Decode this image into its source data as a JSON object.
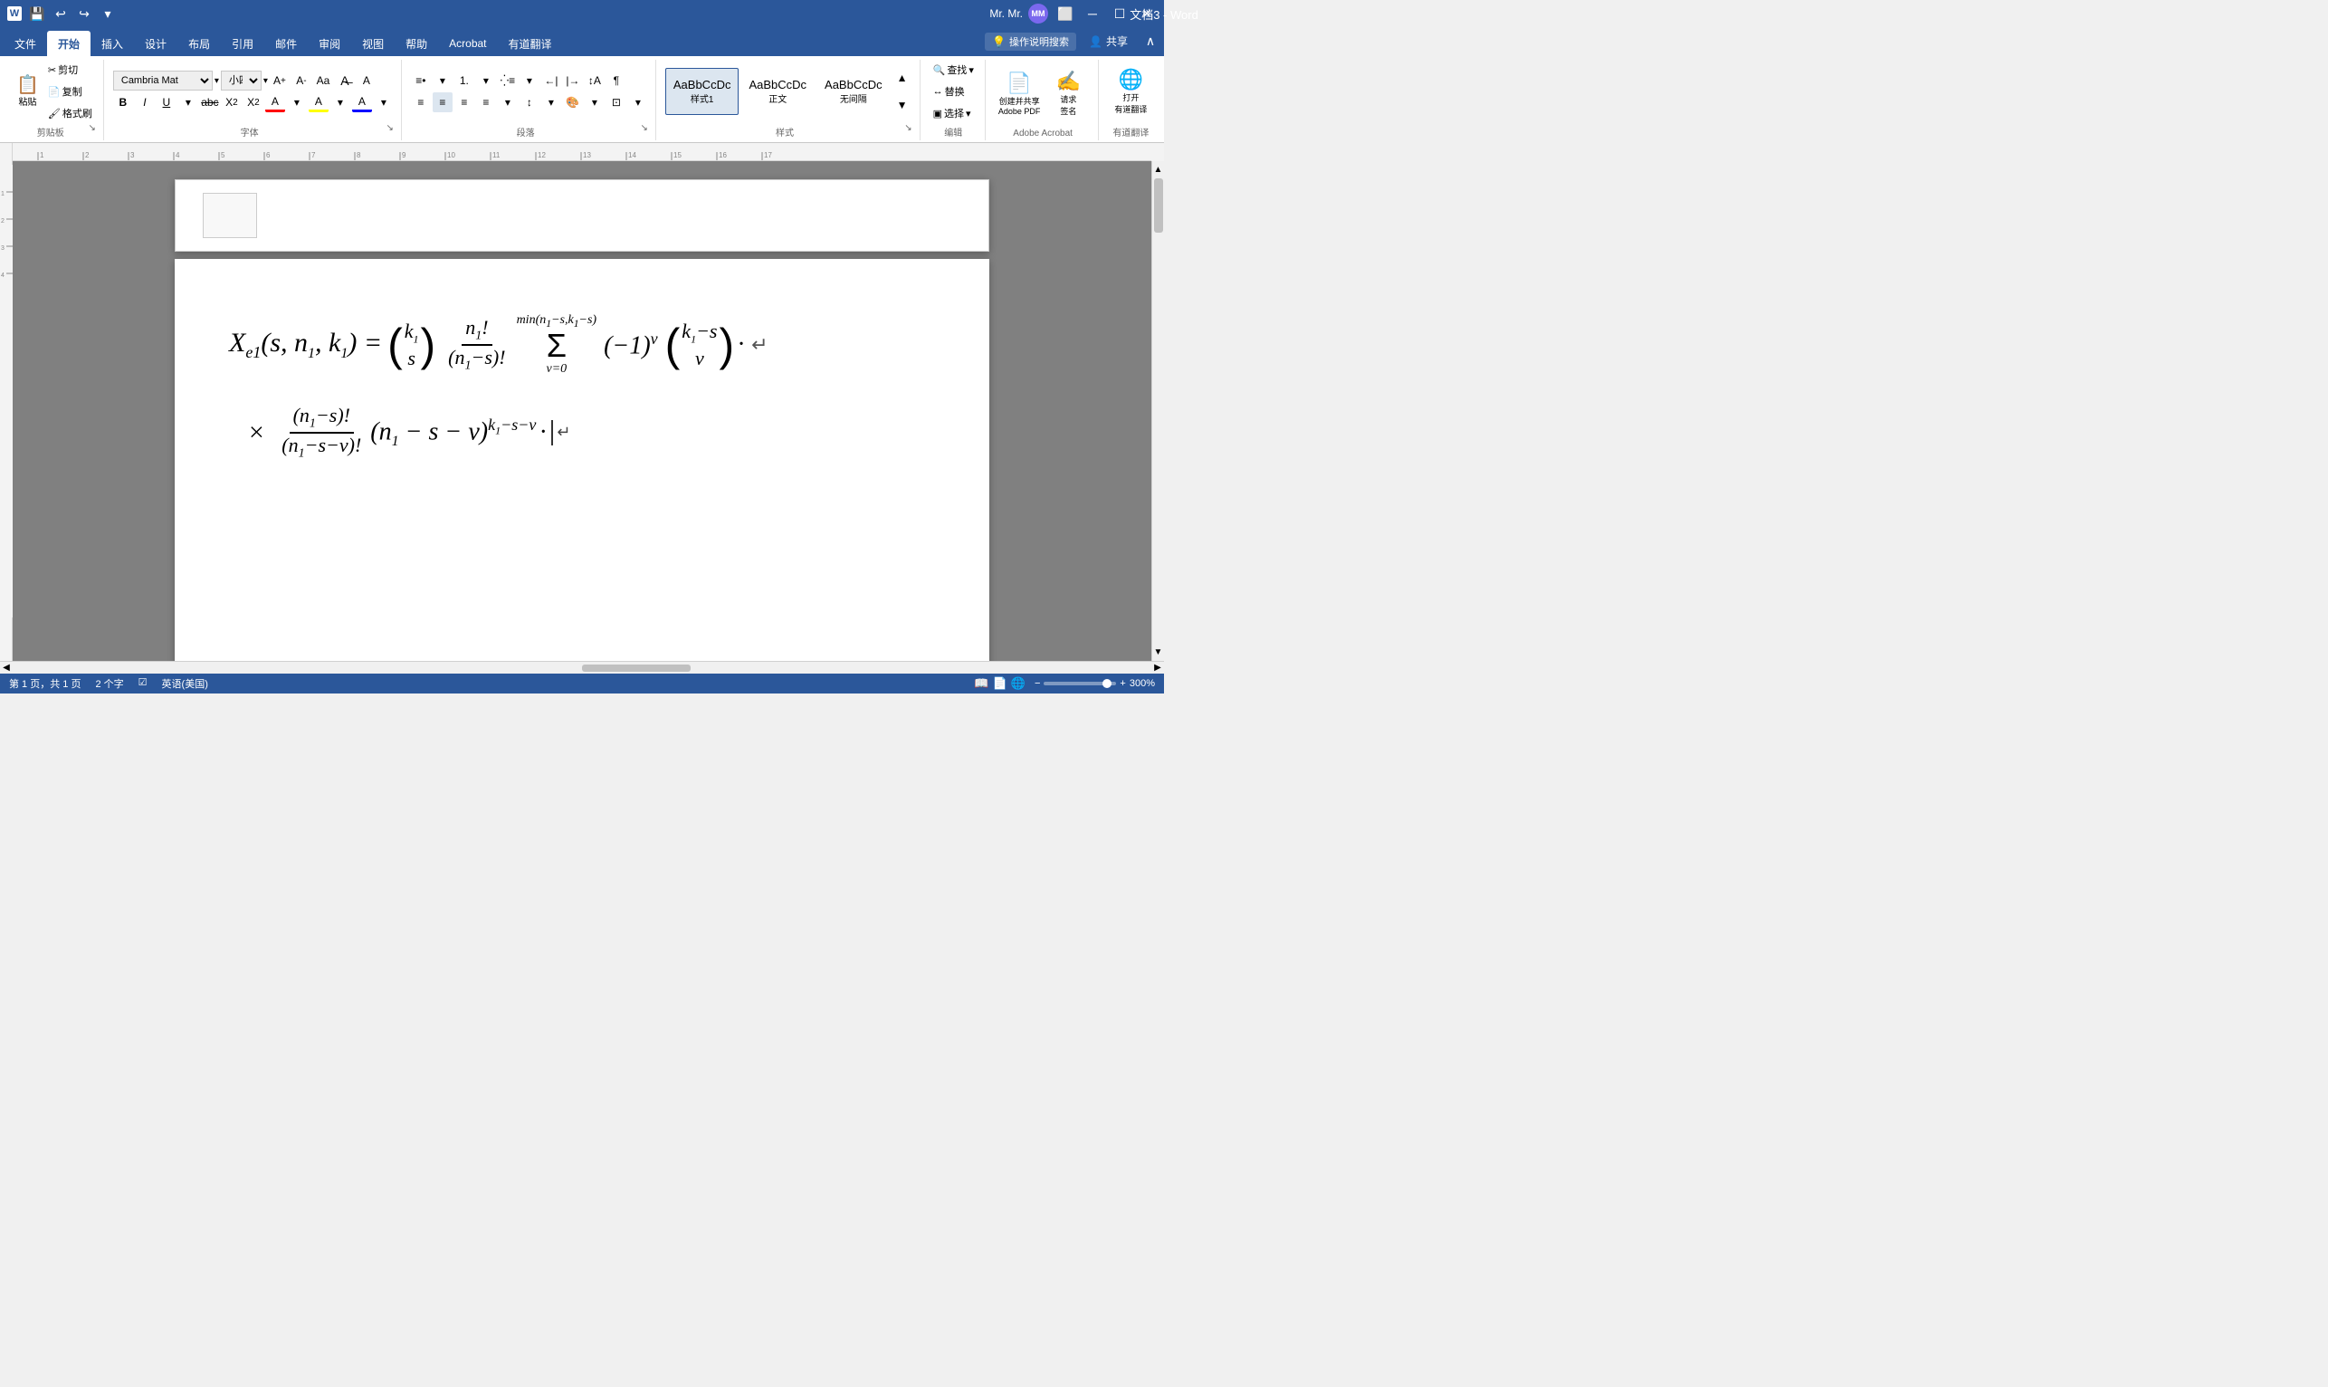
{
  "titlebar": {
    "title": "文档3 - Word",
    "app": "Word",
    "user": "Mr. Mr.",
    "user_initials": "MM",
    "quicktools": [
      "save",
      "undo",
      "redo",
      "dropdown"
    ]
  },
  "ribbontabs": {
    "tabs": [
      "文件",
      "开始",
      "插入",
      "设计",
      "布局",
      "引用",
      "邮件",
      "审阅",
      "视图",
      "帮助",
      "Acrobat",
      "有道翻译"
    ],
    "active": "开始"
  },
  "ribbon": {
    "clipboard": {
      "label": "剪贴板",
      "paste_label": "粘贴",
      "expand": "↘"
    },
    "font": {
      "label": "字体",
      "font_name": "Cambria Mat",
      "font_size": "小四",
      "bold": "B",
      "italic": "I",
      "underline": "U",
      "strikethrough": "abc",
      "subscript": "X₂",
      "superscript": "X²",
      "font_color": "A",
      "highlight": "A",
      "clear": "A",
      "expand": "↘"
    },
    "paragraph": {
      "label": "段落",
      "expand": "↘"
    },
    "styles": {
      "label": "样式",
      "items": [
        {
          "name": "样式1",
          "preview": "AaBbCcDc",
          "active": true
        },
        {
          "name": "正文",
          "preview": "AaBbCcDc"
        },
        {
          "name": "无间隔",
          "preview": "AaBbCcDc"
        }
      ],
      "expand": "↘"
    },
    "editing": {
      "label": "编辑",
      "find": "查找",
      "replace": "替换",
      "select": "选择"
    },
    "acrobat": {
      "label": "Adobe Acrobat",
      "create_share": "创建并共享\nAdobe PDF",
      "sign": "请求\n签名"
    },
    "youdao": {
      "label": "有道翻译",
      "translate": "打开\n有道翻译"
    },
    "toolbar_icons": {
      "search_icon": "🔍",
      "idea_icon": "💡"
    },
    "search_placeholder": "操作说明搜索",
    "share_label": "共享"
  },
  "document": {
    "formula_line1": "X_{e1}(s, n_1, k_1) = (k_1 choose s) · (n_1! / (n_1-s)!) · Σ_{v=0}^{min(n_1-s, k_1-s)} (-1)^v (k_1-s choose v) ·",
    "formula_line2": "× ((n_1-s)! / (n_1-s-v)!) · (n_1 - s - v)^{k_1-s-v} ·"
  },
  "statusbar": {
    "page_info": "第 1 页，共 1 页",
    "word_count": "2 个字",
    "lang_check": "☑",
    "language": "英语(美国)",
    "zoom_level": "300%",
    "view_modes": [
      "read",
      "print",
      "web"
    ]
  },
  "colors": {
    "ribbon_bg": "#2b579a",
    "active_tab_bg": "#ffffff",
    "active_tab_text": "#2b579a",
    "page_bg": "#ffffff",
    "canvas_bg": "#808080"
  }
}
